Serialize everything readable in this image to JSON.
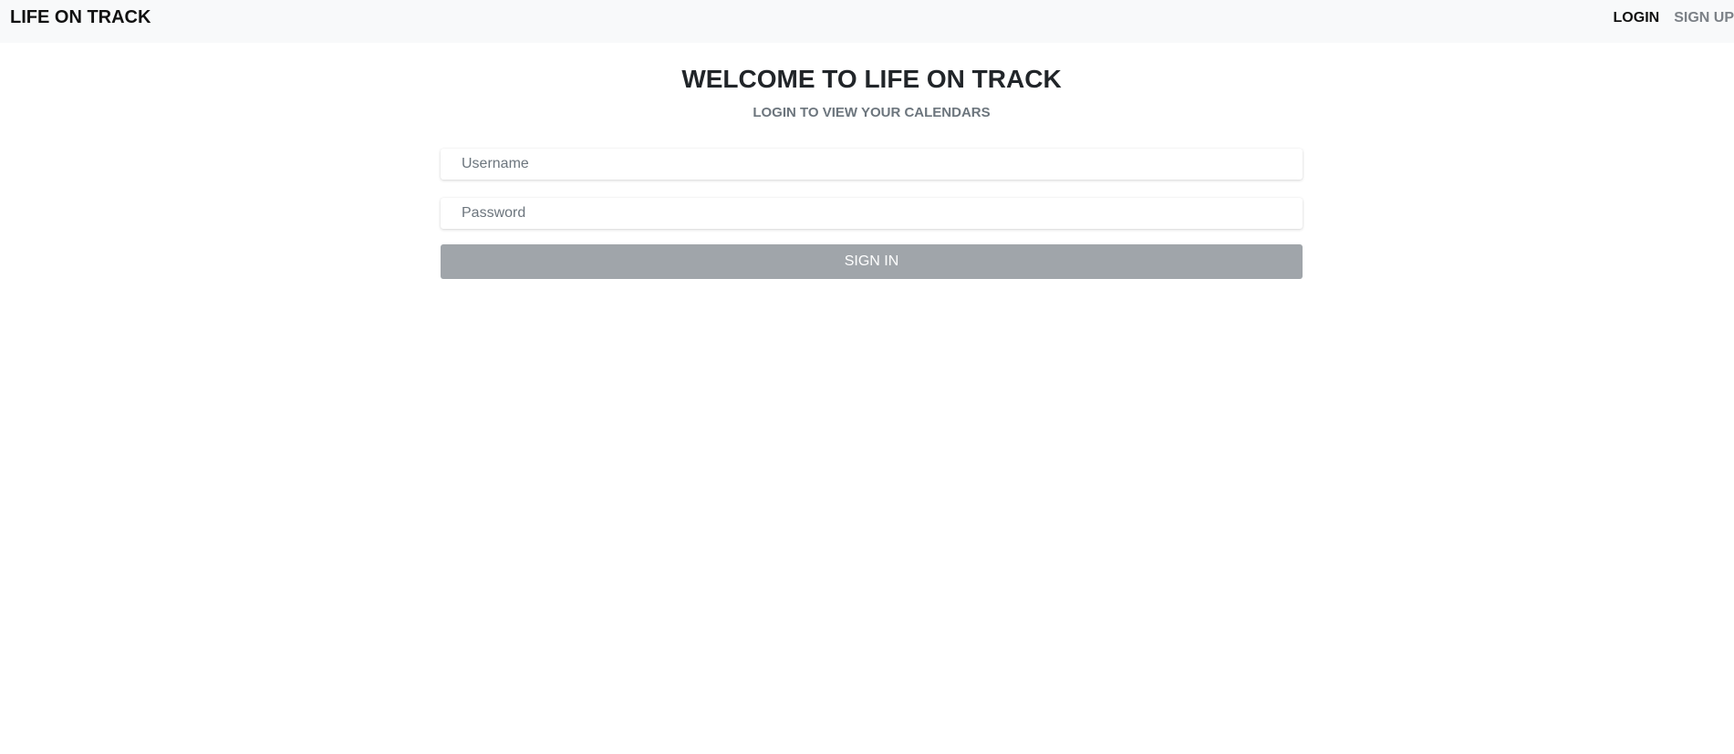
{
  "navbar": {
    "brand": "LIFE ON TRACK",
    "links": {
      "login": "LOGIN",
      "signup": "SIGN UP"
    }
  },
  "main": {
    "title": "WELCOME TO LIFE ON TRACK",
    "subtitle": "LOGIN TO VIEW YOUR CALENDARS",
    "form": {
      "username": {
        "value": "",
        "placeholder": "Username"
      },
      "password": {
        "value": "",
        "placeholder": "Password"
      },
      "submit_label": "SIGN IN"
    }
  },
  "colors": {
    "navbar_background": "#f8f9fa",
    "brand_text": "#111111",
    "active_link": "#111111",
    "inactive_link": "#7c8187",
    "title_text": "#212529",
    "subtitle_text": "#6c757d",
    "button_background": "#a0a5aa",
    "button_text": "#ffffff"
  }
}
